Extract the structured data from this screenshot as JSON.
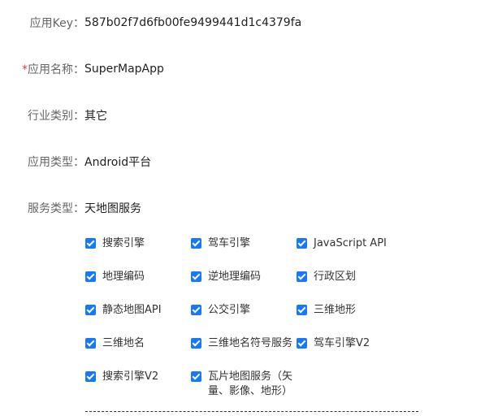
{
  "form": {
    "app_key_label": "应用Key：",
    "app_key_value": "587b02f7d6fb00fe9499441d1c4379fa",
    "app_name_required_mark": "*",
    "app_name_label": "应用名称：",
    "app_name_value": "SuperMapApp",
    "industry_label": "行业类别：",
    "industry_value": "其它",
    "app_type_label": "应用类型：",
    "app_type_value": "Android平台",
    "service_type_label": "服务类型：",
    "service_type_value": "天地图服务"
  },
  "services": [
    {
      "label": "搜索引擎",
      "checked": true
    },
    {
      "label": "驾车引擎",
      "checked": true
    },
    {
      "label": "JavaScript API",
      "checked": true
    },
    {
      "label": "地理编码",
      "checked": true
    },
    {
      "label": "逆地理编码",
      "checked": true
    },
    {
      "label": "行政区划",
      "checked": true
    },
    {
      "label": "静态地图API",
      "checked": true
    },
    {
      "label": "公交引擎",
      "checked": true
    },
    {
      "label": "三维地形",
      "checked": true
    },
    {
      "label": "三维地名",
      "checked": true
    },
    {
      "label": "三维地名符号服务",
      "checked": true
    },
    {
      "label": "驾车引擎V2",
      "checked": true
    },
    {
      "label": "搜索引擎V2",
      "checked": true
    },
    {
      "label": "瓦片地图服务（矢量、影像、地形）",
      "checked": true
    }
  ],
  "colors": {
    "checkbox_fill": "#1677ff",
    "required_mark": "#e4393c",
    "label_text": "#666666",
    "value_text": "#222222"
  }
}
